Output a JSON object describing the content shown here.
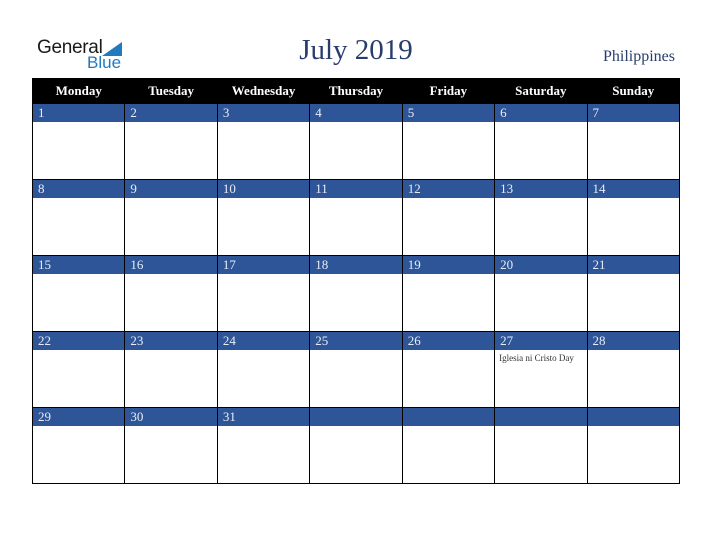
{
  "logo": {
    "word1": "General",
    "word2": "Blue"
  },
  "title": "July 2019",
  "country": "Philippines",
  "colors": {
    "header_bg": "#000000",
    "day_bar": "#2d5597",
    "title": "#283d6b",
    "logo_blue": "#1f7ac0"
  },
  "weekdays": [
    "Monday",
    "Tuesday",
    "Wednesday",
    "Thursday",
    "Friday",
    "Saturday",
    "Sunday"
  ],
  "weeks": [
    [
      {
        "day": "1",
        "event": ""
      },
      {
        "day": "2",
        "event": ""
      },
      {
        "day": "3",
        "event": ""
      },
      {
        "day": "4",
        "event": ""
      },
      {
        "day": "5",
        "event": ""
      },
      {
        "day": "6",
        "event": ""
      },
      {
        "day": "7",
        "event": ""
      }
    ],
    [
      {
        "day": "8",
        "event": ""
      },
      {
        "day": "9",
        "event": ""
      },
      {
        "day": "10",
        "event": ""
      },
      {
        "day": "11",
        "event": ""
      },
      {
        "day": "12",
        "event": ""
      },
      {
        "day": "13",
        "event": ""
      },
      {
        "day": "14",
        "event": ""
      }
    ],
    [
      {
        "day": "15",
        "event": ""
      },
      {
        "day": "16",
        "event": ""
      },
      {
        "day": "17",
        "event": ""
      },
      {
        "day": "18",
        "event": ""
      },
      {
        "day": "19",
        "event": ""
      },
      {
        "day": "20",
        "event": ""
      },
      {
        "day": "21",
        "event": ""
      }
    ],
    [
      {
        "day": "22",
        "event": ""
      },
      {
        "day": "23",
        "event": ""
      },
      {
        "day": "24",
        "event": ""
      },
      {
        "day": "25",
        "event": ""
      },
      {
        "day": "26",
        "event": ""
      },
      {
        "day": "27",
        "event": "Iglesia ni Cristo Day"
      },
      {
        "day": "28",
        "event": ""
      }
    ],
    [
      {
        "day": "29",
        "event": ""
      },
      {
        "day": "30",
        "event": ""
      },
      {
        "day": "31",
        "event": ""
      },
      {
        "day": "",
        "event": ""
      },
      {
        "day": "",
        "event": ""
      },
      {
        "day": "",
        "event": ""
      },
      {
        "day": "",
        "event": ""
      }
    ]
  ]
}
